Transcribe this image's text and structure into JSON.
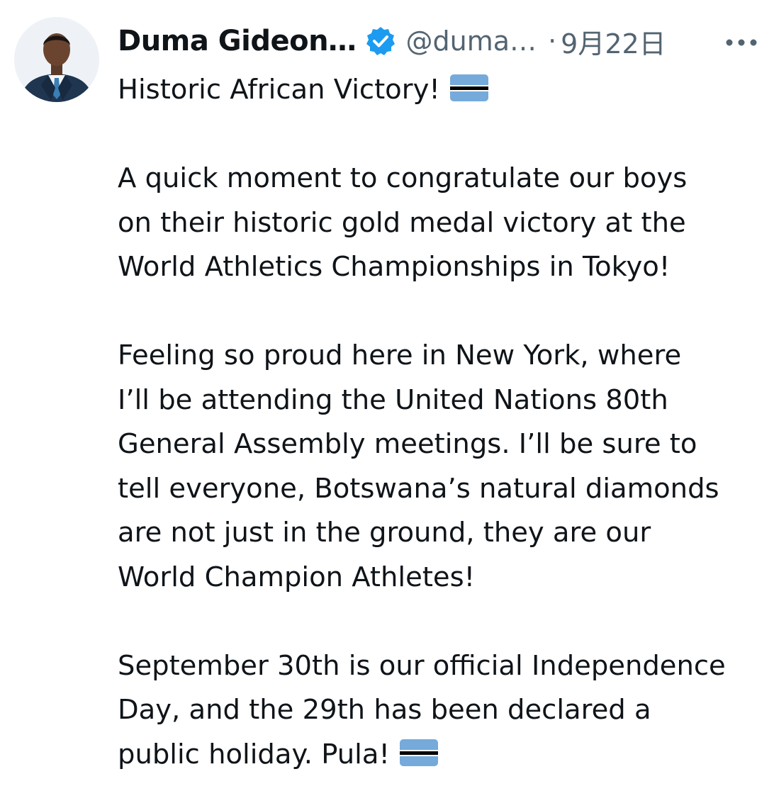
{
  "author": {
    "display_name": "Duma Gideon…",
    "handle": "@duma…",
    "separator": "·",
    "date": "9月22日",
    "verified": true,
    "avatar": "avatar-photo-man-in-suit",
    "verified_icon": "verified-badge-icon"
  },
  "menu": {
    "icon": "more-options-icon"
  },
  "tweet": {
    "title_line": "Historic African Victory!",
    "paragraph1_lines": [
      "A quick moment to congratulate our boys",
      "on their historic gold medal victory at the",
      "World Athletics Championships in Tokyo!"
    ],
    "paragraph2_lines": [
      "Feeling so proud here in New York, where",
      "I’ll be attending the United Nations 80th",
      "General Assembly meetings. I’ll be sure to",
      "tell everyone, Botswana’s natural diamonds",
      "are not just in the ground, they are our",
      "World Champion Athletes!"
    ],
    "paragraph3_lines": [
      "September 30th is our official Independence",
      "Day, and the 29th has been declared a",
      "public holiday. Pula!"
    ],
    "emoji": "flag-botswana-emoji"
  },
  "colors": {
    "text": "#0f1419",
    "secondary": "#536471",
    "verified": "#1d9bf0",
    "flag_blue": "#75aadb"
  }
}
